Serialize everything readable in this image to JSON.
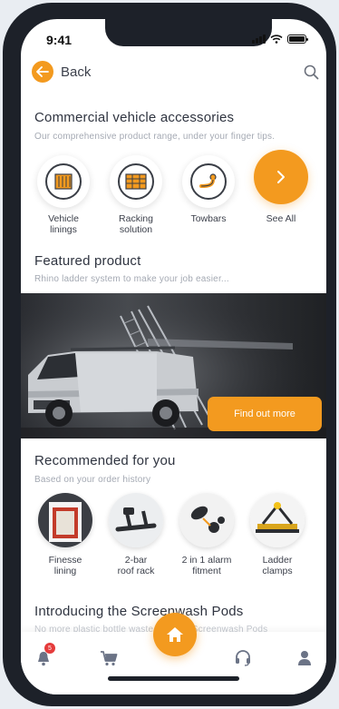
{
  "status_bar": {
    "time": "9:41"
  },
  "header": {
    "back_label": "Back"
  },
  "categories_section": {
    "title": "Commercial vehicle accessories",
    "subtitle": "Our comprehensive product range, under your finger tips.",
    "items": [
      {
        "label_line1": "Vehicle",
        "label_line2": "linings",
        "icon": "vehicle-linings-icon"
      },
      {
        "label_line1": "Racking",
        "label_line2": "solution",
        "icon": "racking-solution-icon"
      },
      {
        "label_line1": "Towbars",
        "label_line2": "",
        "icon": "towbar-icon"
      },
      {
        "label_line1": "See All",
        "label_line2": "",
        "icon": "chevron-right-icon"
      }
    ]
  },
  "featured_section": {
    "title": "Featured product",
    "subtitle": "Rhino ladder system to make your job easier...",
    "cta_label": "Find out more"
  },
  "recommended_section": {
    "title": "Recommended for you",
    "subtitle": "Based on your order history",
    "items": [
      {
        "label_line1": "Finesse",
        "label_line2": "lining"
      },
      {
        "label_line1": "2-bar",
        "label_line2": "roof rack"
      },
      {
        "label_line1": "2 in 1 alarm",
        "label_line2": "fitment"
      },
      {
        "label_line1": "Ladder",
        "label_line2": "clamps"
      }
    ]
  },
  "promo_section": {
    "title": "Introducing the Screenwash Pods",
    "subtitle": "No more plastic bottle waste with our Screenwash Pods"
  },
  "tab_bar": {
    "notifications_badge": "5",
    "tabs": [
      "notifications",
      "cart",
      "home",
      "support",
      "account"
    ]
  },
  "colors": {
    "accent": "#f39a1f",
    "text": "#2f3440",
    "muted": "#a4a9b3",
    "badge": "#e53b3b"
  }
}
